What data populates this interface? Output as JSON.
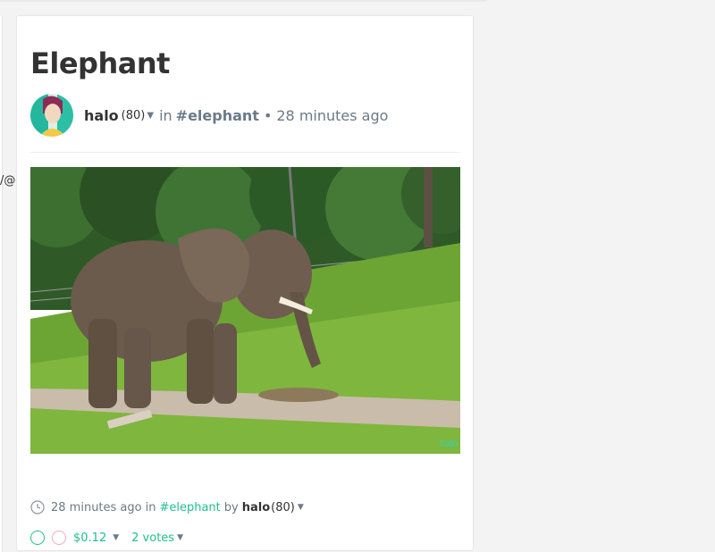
{
  "left_fragment": "/@",
  "post": {
    "title": "Elephant",
    "author": "halo",
    "reputation": "(80)",
    "in_label": "in",
    "tag": "#elephant",
    "separator": "•",
    "time_ago": "28 minutes ago",
    "image_alt": "Elephant eating hay in grassy enclosure",
    "watermark": "halo"
  },
  "footer": {
    "time_ago": "28 minutes ago",
    "in_label": "in",
    "tag": "#elephant",
    "by_label": "by",
    "author": "halo",
    "reputation": "(80)"
  },
  "votes": {
    "payout": "$0.12",
    "count_label": "2 votes"
  },
  "colors": {
    "accent": "#1fbf8f",
    "muted": "#6b7a88",
    "flag": "#f3aaba"
  }
}
